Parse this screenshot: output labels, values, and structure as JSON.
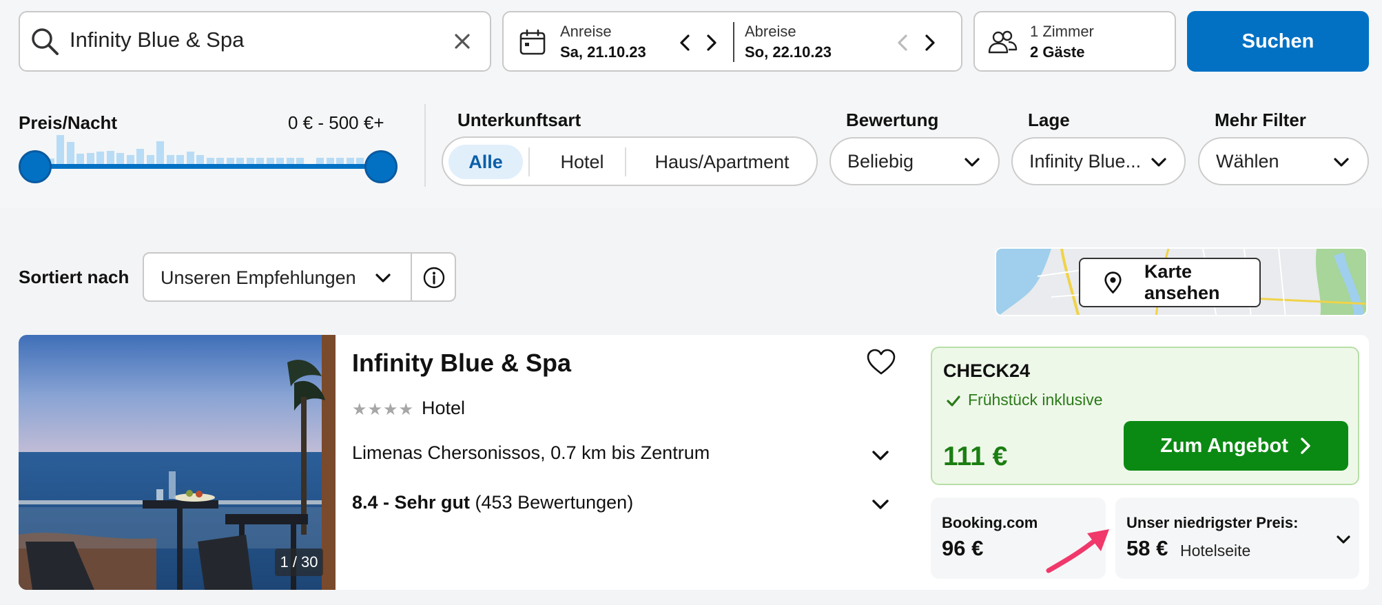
{
  "search": {
    "destination": "Infinity Blue & Spa",
    "arrival_label": "Anreise",
    "arrival_date": "Sa, 21.10.23",
    "departure_label": "Abreise",
    "departure_date": "So, 22.10.23",
    "rooms": "1 Zimmer",
    "guests": "2 Gäste",
    "submit_label": "Suchen"
  },
  "filters": {
    "price": {
      "title": "Preis/Nacht",
      "range": "0 € - 500 €+",
      "histogram": [
        0.2,
        1.0,
        0.75,
        0.35,
        0.38,
        0.42,
        0.45,
        0.38,
        0.3,
        0.52,
        0.3,
        0.78,
        0.3,
        0.3,
        0.42,
        0.3,
        0.22,
        0.22,
        0.22,
        0.22,
        0.22,
        0.22,
        0.22,
        0.22,
        0.22,
        0.22,
        0.0,
        0.22,
        0.22,
        0.22,
        0.22,
        0.22
      ]
    },
    "accommodation": {
      "title": "Unterkunftsart",
      "options": [
        "Alle",
        "Hotel",
        "Haus/Apartment"
      ],
      "selected": "Alle"
    },
    "rating": {
      "title": "Bewertung",
      "value": "Beliebig"
    },
    "location": {
      "title": "Lage",
      "value": "Infinity Blue..."
    },
    "more": {
      "title": "Mehr Filter",
      "value": "Wählen"
    }
  },
  "sort": {
    "label": "Sortiert nach",
    "value": "Unseren Empfehlungen"
  },
  "map": {
    "button_label": "Karte ansehen"
  },
  "hotel": {
    "name": "Infinity Blue & Spa",
    "stars": 4,
    "type": "Hotel",
    "location": "Limenas Chersonissos, 0.7 km bis Zentrum",
    "rating_text": "8.4 - Sehr gut",
    "reviews": "(453 Bewertungen)",
    "photo_counter": "1 / 30",
    "offer": {
      "provider": "CHECK24",
      "inclusion": "Frühstück inklusive",
      "price": "111 €",
      "cta": "Zum Angebot"
    },
    "alt_offer": {
      "provider": "Booking.com",
      "price": "96 €"
    },
    "lowest": {
      "label": "Unser niedrigster Preis:",
      "price": "58 €",
      "source": "Hotelseite"
    }
  },
  "colors": {
    "primary_blue": "#0271c4",
    "cta_green": "#0b8a13",
    "price_green": "#1b7e12",
    "offer_bg": "#eef8e9",
    "annotation_pink": "#f0386b"
  }
}
